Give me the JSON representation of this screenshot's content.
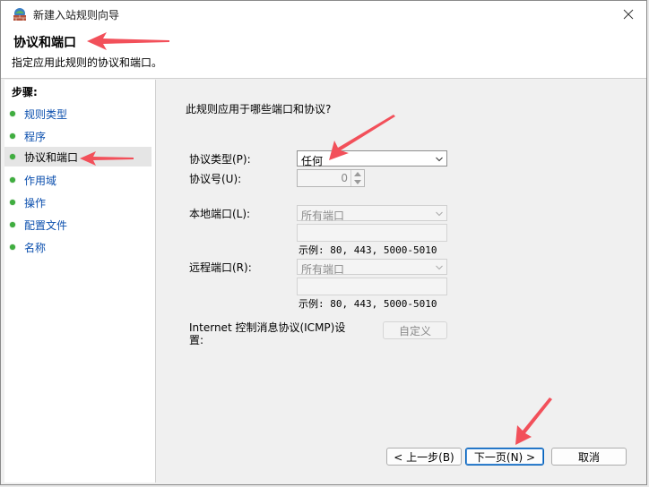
{
  "window": {
    "title": "新建入站规则向导"
  },
  "header": {
    "title": "协议和端口",
    "subtitle": "指定应用此规则的协议和端口。"
  },
  "steps": {
    "title": "步骤:",
    "items": [
      {
        "label": "规则类型"
      },
      {
        "label": "程序"
      },
      {
        "label": "协议和端口"
      },
      {
        "label": "作用域"
      },
      {
        "label": "操作"
      },
      {
        "label": "配置文件"
      },
      {
        "label": "名称"
      }
    ]
  },
  "main": {
    "question": "此规则应用于哪些端口和协议?",
    "protocol_type_label": "协议类型(P):",
    "protocol_type_value": "任何",
    "protocol_number_label": "协议号(U):",
    "protocol_number_value": "0",
    "local_port_label": "本地端口(L):",
    "local_port_value": "所有端口",
    "local_example": "示例: 80, 443, 5000-5010",
    "remote_port_label": "远程端口(R):",
    "remote_port_value": "所有端口",
    "remote_example": "示例: 80, 443, 5000-5010",
    "icmp_label": "Internet 控制消息协议(ICMP)设置:",
    "customize_label": "自定义"
  },
  "buttons": {
    "back": "< 上一步(B)",
    "next": "下一页(N) >",
    "cancel": "取消"
  },
  "colors": {
    "accent": "#005fb8",
    "annotation": "#f2505a",
    "bullet": "#3fae3f",
    "link": "#0b4fae"
  }
}
